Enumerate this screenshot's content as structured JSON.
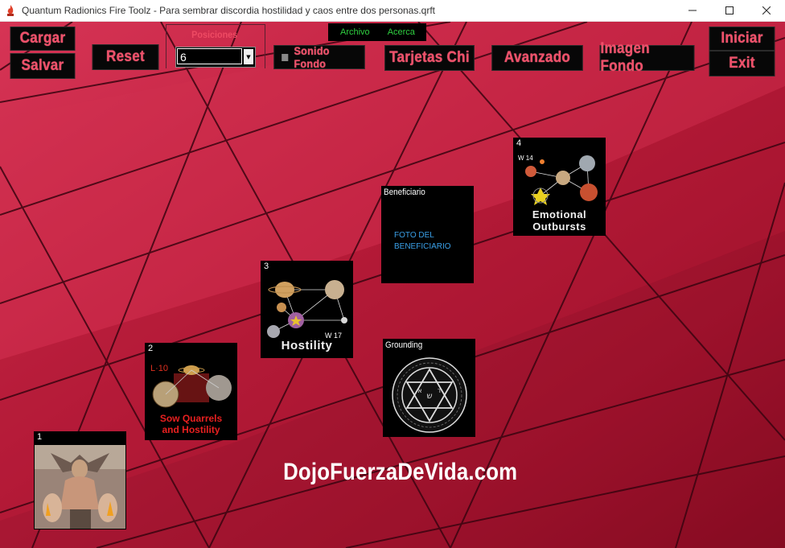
{
  "window": {
    "title": "Quantum Radionics Fire Toolz - Para sembrar discordia hostilidad y caos entre dos personas.qrft",
    "minimize_icon": "minimize-icon",
    "maximize_icon": "maximize-icon",
    "close_icon": "close-icon"
  },
  "toolbar": {
    "cargar": "Cargar",
    "salvar": "Salvar",
    "reset": "Reset",
    "posiciones_label": "Posiciones",
    "posiciones_value": "6",
    "sonido_fondo": "Sonido Fondo",
    "tarjetas_chi": "Tarjetas Chi",
    "avanzado": "Avanzado",
    "imagen_fondo": "Imagen Fondo",
    "iniciar": "Iniciar",
    "exit": "Exit"
  },
  "menu": {
    "archivo": "Archivo",
    "acerca": "Acerca"
  },
  "colors": {
    "background": "#b81a3c",
    "button_text": "#f0506a",
    "menu_text": "#2fd040",
    "card_bg": "#000000"
  },
  "cards": {
    "card1": {
      "number": "1"
    },
    "card2": {
      "number": "2",
      "badge": "L·10",
      "caption_line1": "Sow Quarrels",
      "caption_line2": "and Hostility"
    },
    "card3": {
      "number": "3",
      "badge": "W 17",
      "caption": "Hostility"
    },
    "card4": {
      "number": "4",
      "badge": "W 14",
      "caption_line1": "Emotional",
      "caption_line2": "Outbursts"
    },
    "beneficiario": {
      "label": "Beneficiario",
      "line1": "FOTO DEL",
      "line2": "BENEFICIARIO"
    },
    "grounding": {
      "label": "Grounding"
    }
  },
  "watermark": "DojoFuerzaDeVida.com"
}
